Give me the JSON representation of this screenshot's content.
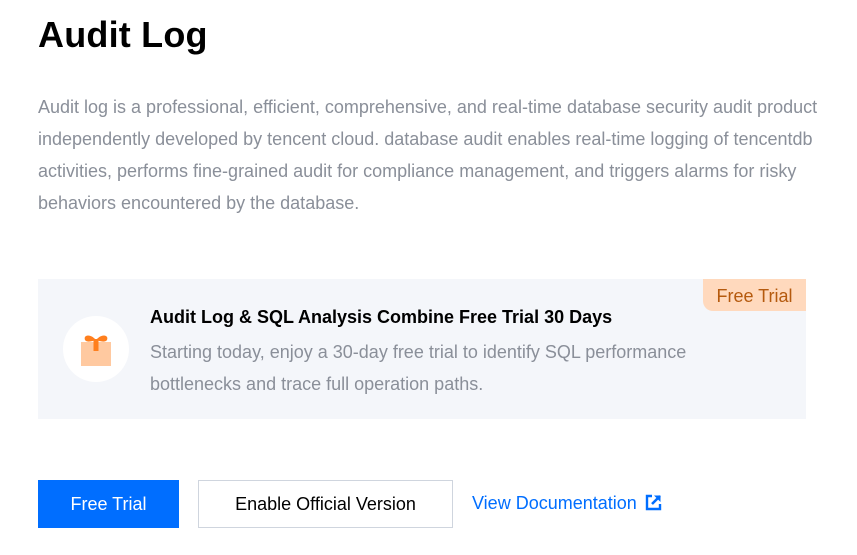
{
  "page": {
    "title": "Audit Log",
    "description": "Audit log is a professional, efficient, comprehensive, and real-time database security audit product independently developed by tencent cloud. database audit enables real-time logging of tencentdb activities, performs fine-grained audit for compliance management, and triggers alarms for risky behaviors encountered by the database."
  },
  "promo_card": {
    "badge": "Free Trial",
    "icon": "gift-icon",
    "title": "Audit Log & SQL Analysis Combine Free Trial 30 Days",
    "text": "Starting today, enjoy a 30-day free trial to identify SQL performance bottlenecks and trace full operation paths."
  },
  "actions": {
    "free_trial_label": "Free Trial",
    "enable_official_label": "Enable Official Version",
    "view_documentation_label": "View Documentation",
    "external_link_icon": "external-link-icon"
  },
  "colors": {
    "primary": "#006eff",
    "badge_bg": "#ffd9bd",
    "badge_text": "#b55a0e",
    "card_bg": "#f4f6fa",
    "muted_text": "#8a8f99"
  }
}
